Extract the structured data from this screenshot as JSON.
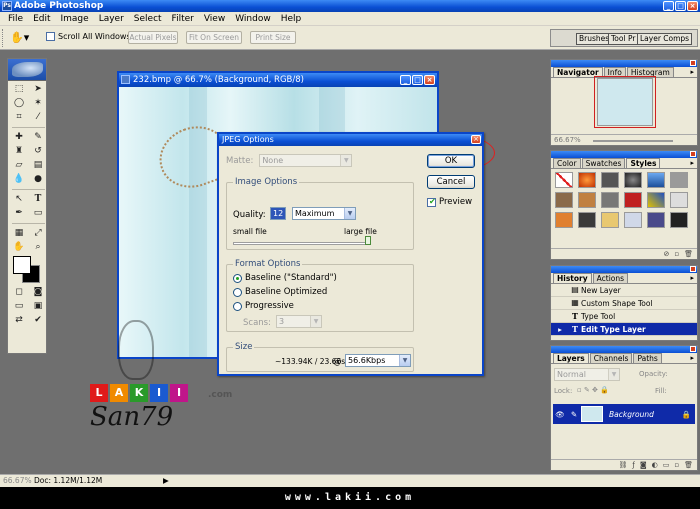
{
  "app": {
    "title": "Adobe Photoshop"
  },
  "menu": [
    "File",
    "Edit",
    "Image",
    "Layer",
    "Select",
    "Filter",
    "View",
    "Window",
    "Help"
  ],
  "options_bar": {
    "scroll_all": "Scroll All Windows",
    "actual_pixels": "Actual Pixels",
    "fit_on_screen": "Fit On Screen",
    "print_size": "Print Size",
    "well_tabs": [
      "Brushes",
      "Tool Pr",
      "Layer Comps"
    ]
  },
  "document": {
    "title": "232.bmp @ 66.7% (Background, RGB/8)"
  },
  "dialog": {
    "title": "JPEG Options",
    "matte_label": "Matte:",
    "matte_value": "None",
    "ok": "OK",
    "cancel": "Cancel",
    "preview": "Preview",
    "image_options": {
      "title": "Image Options",
      "quality_label": "Quality:",
      "quality_value": "12",
      "quality_preset": "Maximum",
      "small_file": "small file",
      "large_file": "large file",
      "slider_fraction": 1.0
    },
    "format_options": {
      "title": "Format Options",
      "baseline": "Baseline (\"Standard\")",
      "baseline_optimized": "Baseline Optimized",
      "progressive": "Progressive",
      "scans_label": "Scans:",
      "scans_value": "3"
    },
    "size": {
      "title": "Size",
      "estimate": "~133.94K / 23.66s",
      "at": "@",
      "speed": "56.6Kbps"
    }
  },
  "navigator": {
    "tabs": [
      "Navigator",
      "Info",
      "Histogram"
    ],
    "zoom": "66.67%"
  },
  "styles": {
    "tabs": [
      "Color",
      "Swatches",
      "Styles"
    ]
  },
  "history": {
    "tabs": [
      "History",
      "Actions"
    ],
    "items": [
      "New Layer",
      "Custom Shape Tool",
      "Type Tool",
      "Edit Type Layer"
    ]
  },
  "layers": {
    "tabs": [
      "Layers",
      "Channels",
      "Paths"
    ],
    "blend": "Normal",
    "opacity_label": "Opacity:",
    "lock_label": "Lock:",
    "fill_label": "Fill:",
    "layer_name": "Background"
  },
  "status": {
    "zoom": "66.67%",
    "doc": "Doc: 1.12M/1.12M"
  },
  "watermark": {
    "com": ".com",
    "signature": "San79",
    "letters": [
      "L",
      "A",
      "K",
      "I",
      "I"
    ]
  },
  "footer": {
    "url": "www.lakii.com"
  },
  "colors": {
    "accent": "#0a4fd4",
    "selection": "#0f2aa8",
    "callout": "#e02020"
  }
}
